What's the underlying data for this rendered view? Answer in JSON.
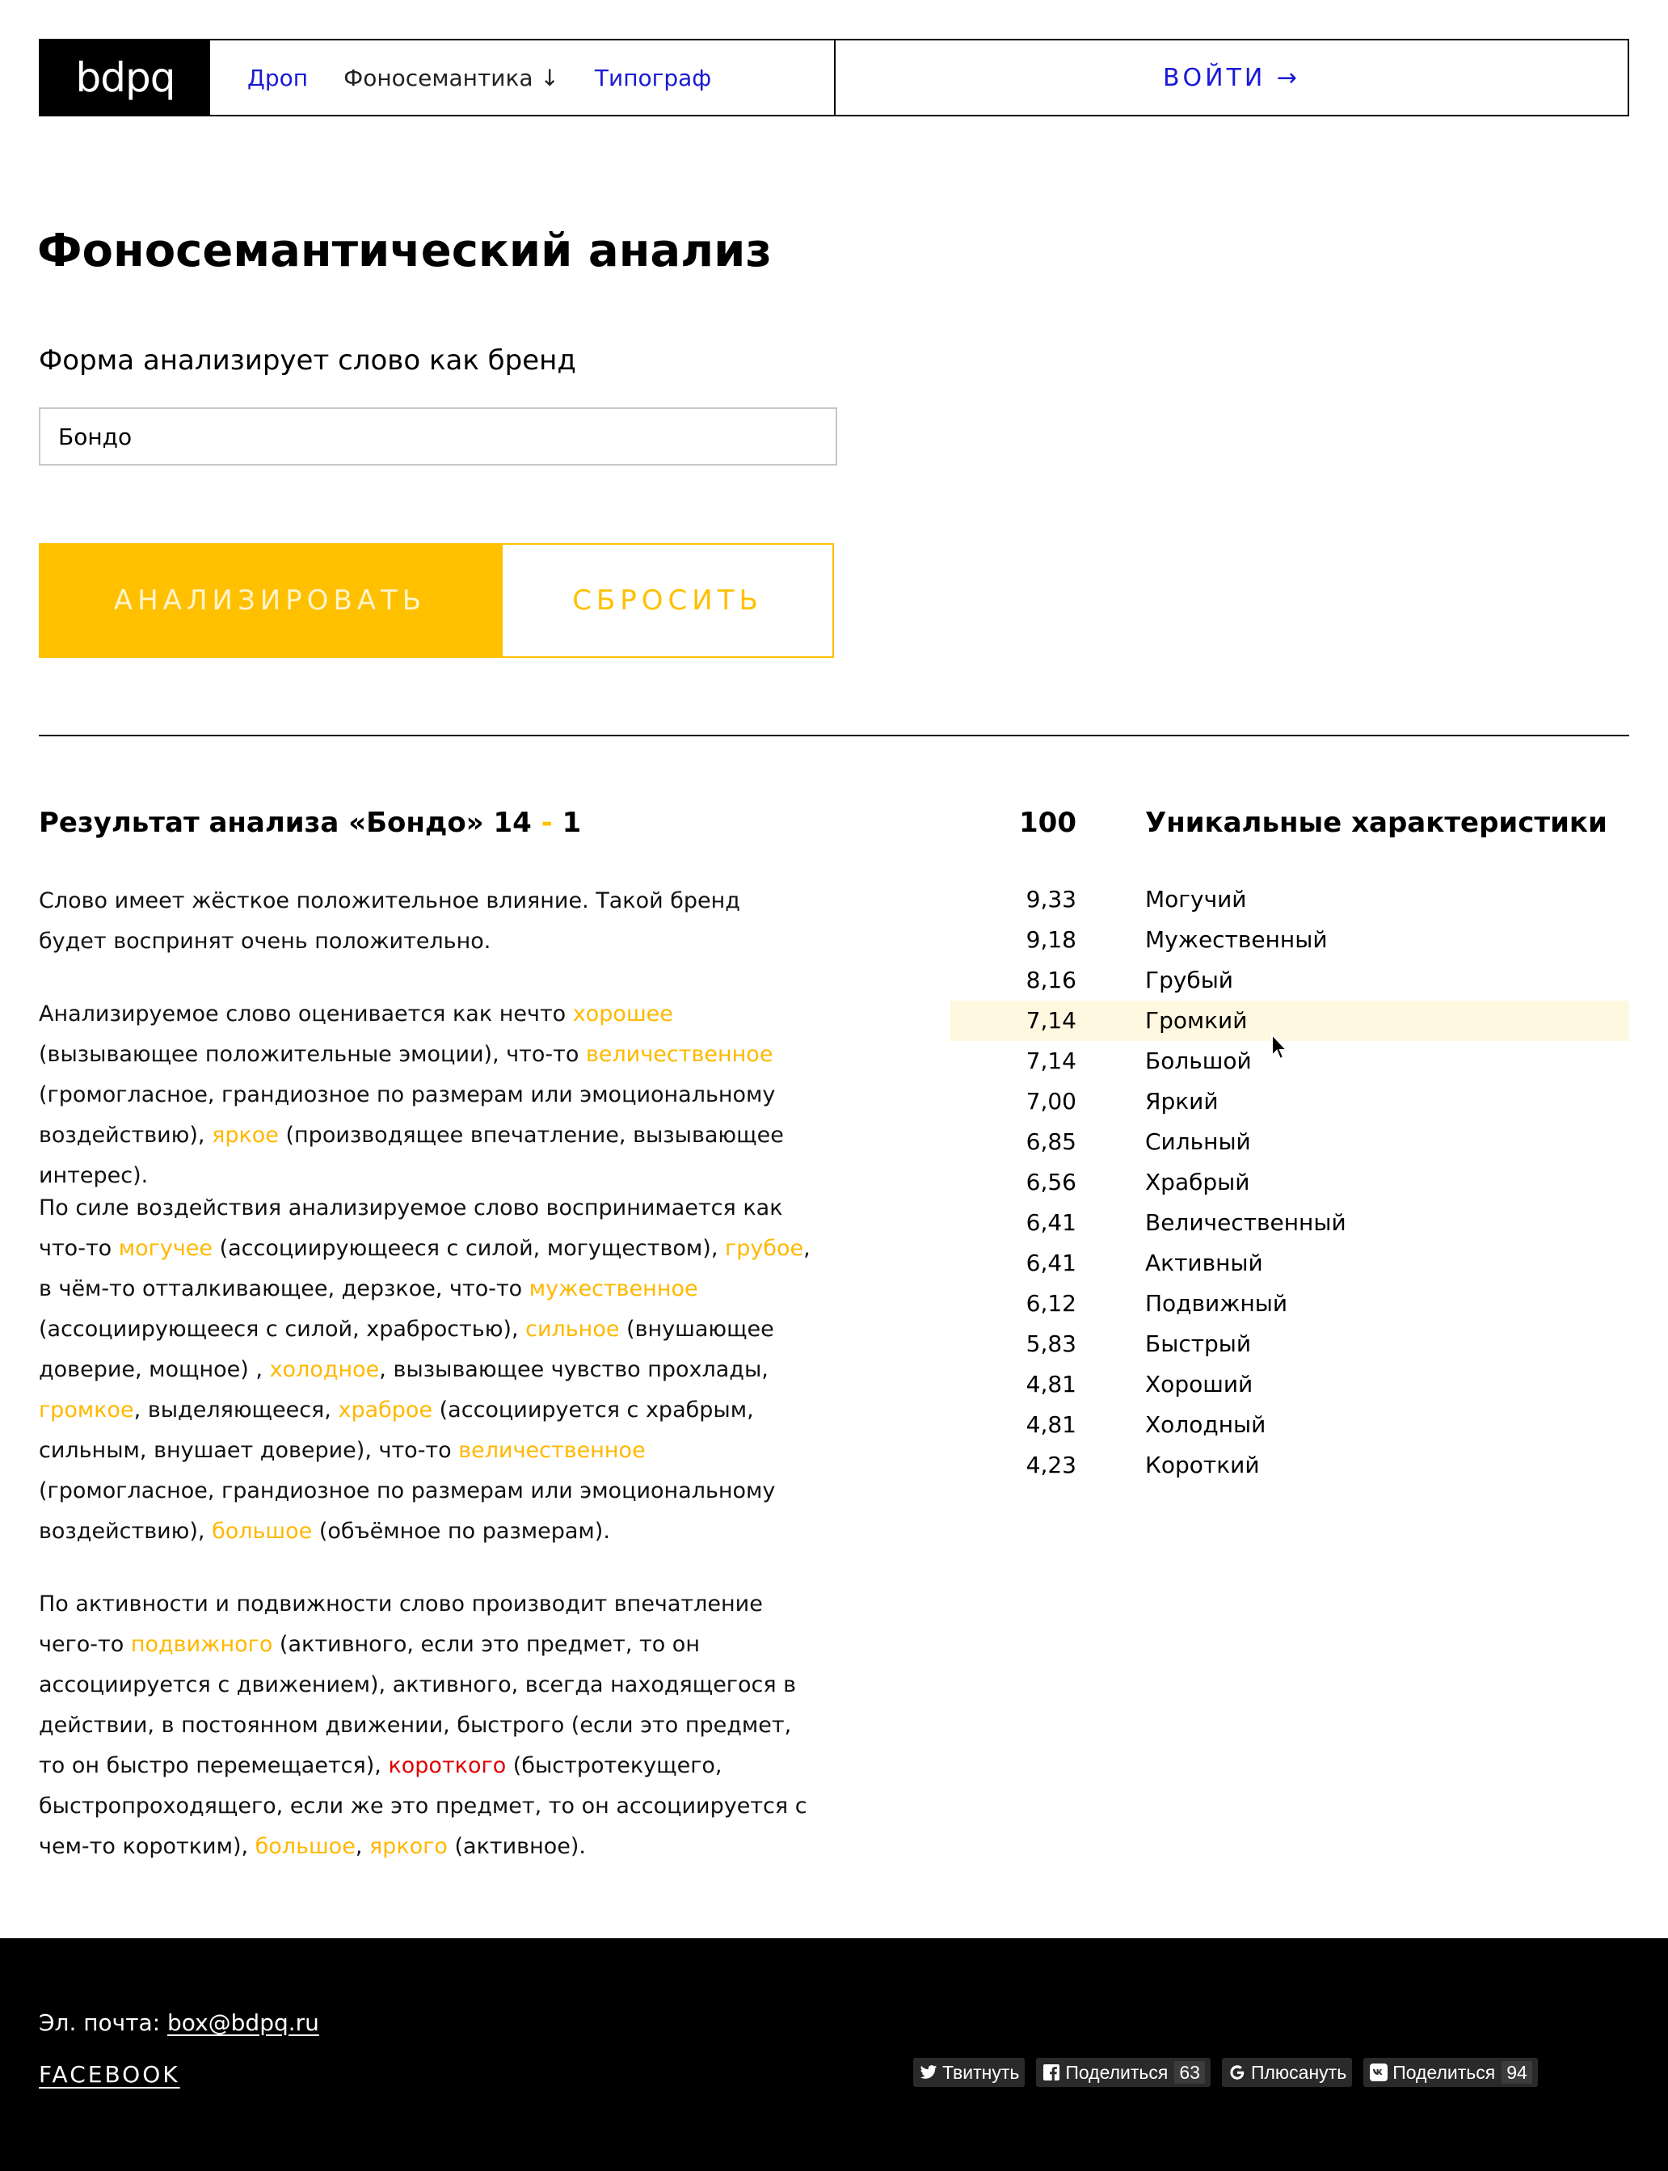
{
  "nav": {
    "logo": "bdpq",
    "links": [
      "Дроп",
      "Фоносемантика ↓",
      "Типограф"
    ],
    "login": "ВОЙТИ →"
  },
  "form": {
    "title": "Фоносемантический анализ",
    "label": "Форма анализирует слово как бренд",
    "input_value": "Бондо",
    "analyze_label": "АНАЛИЗИРОВАТЬ",
    "reset_label": "СБРОСИТЬ"
  },
  "result": {
    "title_prefix": "Результат анализа «Бондо» 14",
    "title_dash": " - ",
    "title_suffix": "1",
    "p1": "Слово имеет жёсткое положительное влияние. Такой бренд будет воспринят очень положительно.",
    "p2": {
      "t1": "Анализируемое слово оценивается как нечто ",
      "h1": "хорошее",
      "t2": " (вызывающее положительные эмоции), что-то ",
      "h2": "величественное",
      "t3": " (громогласное, грандиозное по размерам или эмоциональному воздействию), ",
      "h3": "яркое",
      "t4": " (производящее впечатление, вызывающее интерес)."
    },
    "p3": {
      "t1": "По силе воздействия анализируемое слово воспринимается как что-то ",
      "h1": "могучее",
      "t2": " (ассоциирующееся с силой, могуществом), ",
      "h2": "грубое",
      "t3": ", в чём-то отталкивающее, дерзкое, что-то ",
      "h3": "мужественное",
      "t4": " (ассоциирующееся с силой, храбростью), ",
      "h4": "сильное",
      "t5": " (внушающее доверие, мощное) , ",
      "h5": "холодное",
      "t6": ", вызывающее чувство прохлады, ",
      "h6": "громкое",
      "t7": ", выделяющееся, ",
      "h7": "храброе",
      "t8": " (ассоциируется с храбрым, сильным, внушает доверие), что-то ",
      "h8": "величественное",
      "t9": " (громогласное, грандиозное по размерам или эмоциональному воздействию), ",
      "h9": "большое",
      "t10": " (объёмное по размерам)."
    },
    "p4": {
      "t1": "По активности и подвижности слово производит впечатление чего-то ",
      "h1": "подвижного",
      "t2": " (активного, если это предмет, то он ассоциируется с движением), активного, всегда находящегося в действии, в постоянном движении, быстрого (если это предмет, то он быстро перемещается), ",
      "r1": "короткого",
      "t3": " (быстротекущего, быстропроходящего, если же это предмет, то он ассоциируется с чем-то коротким), ",
      "h2": "большое",
      "t4": ", ",
      "h3": "яркого",
      "t5": " (активное)."
    }
  },
  "characteristics": {
    "total": "100",
    "title": "Уникальные характеристики",
    "items": [
      {
        "value": "9,33",
        "label": "Могучий"
      },
      {
        "value": "9,18",
        "label": "Мужественный"
      },
      {
        "value": "8,16",
        "label": "Грубый"
      },
      {
        "value": "7,14",
        "label": "Громкий"
      },
      {
        "value": "7,14",
        "label": "Большой"
      },
      {
        "value": "7,00",
        "label": "Яркий"
      },
      {
        "value": "6,85",
        "label": "Сильный"
      },
      {
        "value": "6,56",
        "label": "Храбрый"
      },
      {
        "value": "6,41",
        "label": "Величественный"
      },
      {
        "value": "6,41",
        "label": "Активный"
      },
      {
        "value": "6,12",
        "label": "Подвижный"
      },
      {
        "value": "5,83",
        "label": "Быстрый"
      },
      {
        "value": "4,81",
        "label": "Хороший"
      },
      {
        "value": "4,81",
        "label": "Холодный"
      },
      {
        "value": "4,23",
        "label": "Короткий"
      }
    ]
  },
  "footer": {
    "email_label": "Эл. почта: ",
    "email": "box@bdpq.ru",
    "facebook": "FACEBOOK",
    "share": [
      {
        "icon": "twitter-icon",
        "label": "Твитнуть"
      },
      {
        "icon": "facebook-icon",
        "label": "Поделиться",
        "count": "63"
      },
      {
        "icon": "google-icon",
        "label": "Плюсануть"
      },
      {
        "icon": "vk-icon",
        "label": "Поделиться",
        "count": "94"
      }
    ]
  },
  "colors": {
    "accent": "#ffc000",
    "link": "#1a1ad6",
    "highlight": "#ffb800",
    "negative": "#e00000",
    "hover_row": "#fff8e1"
  }
}
